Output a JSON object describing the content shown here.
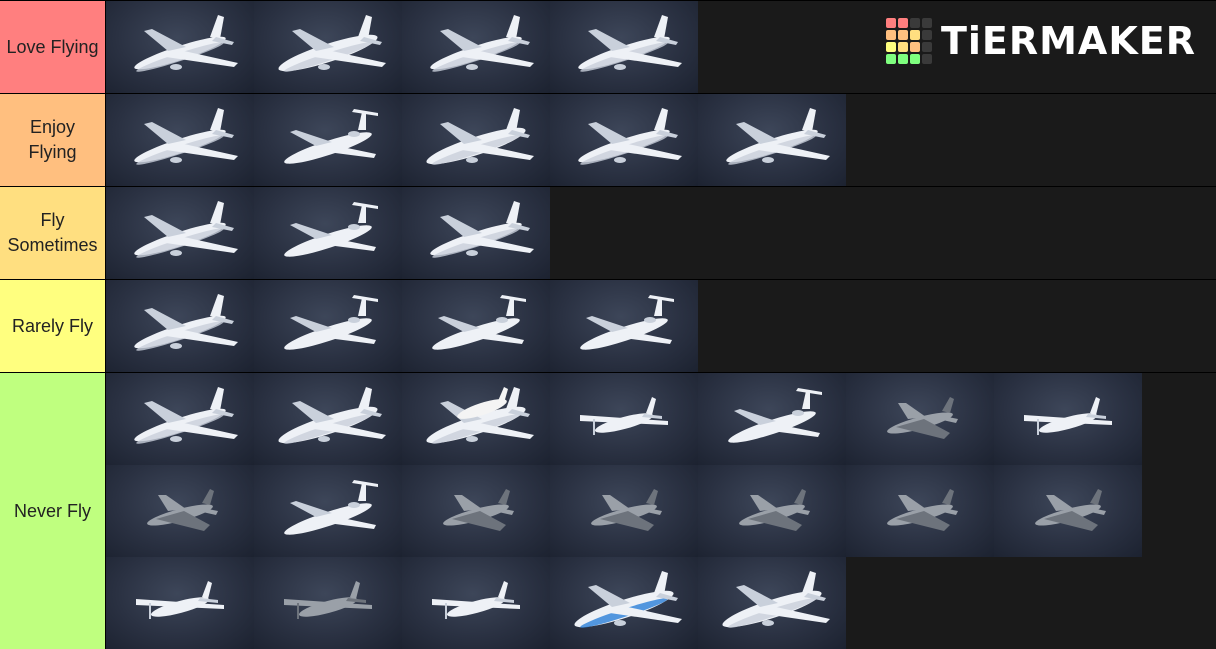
{
  "logo": {
    "text": "TiERMAKER",
    "grid_colors": [
      "#ff7f7f",
      "#ff7f7f",
      "#3a3a3a",
      "#3a3a3a",
      "#ffbf7f",
      "#ffbf7f",
      "#ffdf80",
      "#3a3a3a",
      "#ffff7f",
      "#ffdf80",
      "#ffbf7f",
      "#3a3a3a",
      "#7fff7f",
      "#7fff7f",
      "#7fff7f",
      "#3a3a3a"
    ]
  },
  "tiers": [
    {
      "label": "Love Flying",
      "color": "#ff7f7f",
      "items": [
        "airliner-twin",
        "airliner-747",
        "airliner-twin",
        "airliner-twin"
      ]
    },
    {
      "label": "Enjoy Flying",
      "color": "#ffbf7f",
      "items": [
        "airliner-twin",
        "trijet",
        "trijet-wide",
        "airliner-twin",
        "airliner-twin"
      ]
    },
    {
      "label": "Fly Sometimes",
      "color": "#ffdf80",
      "items": [
        "airliner-twin",
        "t-tail-jet",
        "airliner-twin"
      ]
    },
    {
      "label": "Rarely Fly",
      "color": "#ffff7f",
      "items": [
        "airliner-twin",
        "t-tail-jet",
        "turboprop-t-tail",
        "cargo-t-tail"
      ]
    },
    {
      "label": "Never Fly",
      "color": "#bfff7f",
      "items": [
        "airliner-twin",
        "airliner-747",
        "shuttle-carrier",
        "light-single-prop",
        "business-jet",
        "twin-boom-fighter",
        "light-twin-prop",
        "stealth-fighter",
        "military-transport",
        "swept-wing-fighter",
        "delta-fighter",
        "twin-tail-fighter",
        "ww2-fighter",
        "attack-jet",
        "light-single-prop",
        "vintage-monoplane",
        "light-twin-prop",
        "airliner-747-blue",
        "airliner-double-deck"
      ]
    }
  ]
}
